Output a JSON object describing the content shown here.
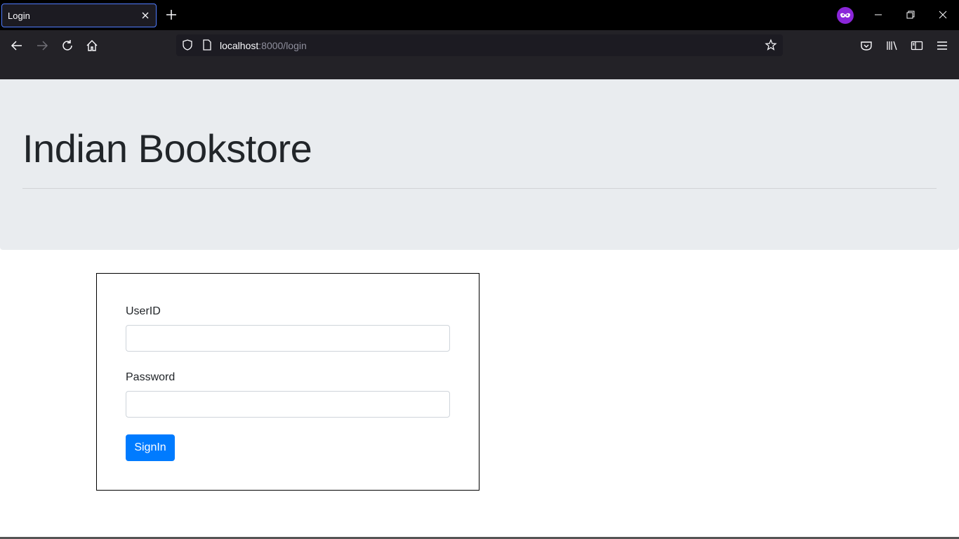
{
  "browser": {
    "tab_title": "Login",
    "url_host": "localhost",
    "url_rest": ":8000/login"
  },
  "page": {
    "site_title": "Indian Bookstore",
    "userid_label": "UserID",
    "userid_value": "",
    "password_label": "Password",
    "password_value": "",
    "signin_label": "SignIn"
  },
  "colors": {
    "jumbotron_bg": "#e9ecef",
    "primary_button": "#007bff",
    "private_badge": "#8b26d9"
  },
  "icons": [
    "close-icon",
    "plus-icon",
    "private-browsing-icon",
    "minimize-icon",
    "restore-icon",
    "window-close-icon",
    "back-icon",
    "forward-icon",
    "reload-icon",
    "home-icon",
    "shield-icon",
    "page-icon",
    "star-icon",
    "pocket-icon",
    "library-icon",
    "sidebar-icon",
    "menu-icon"
  ]
}
